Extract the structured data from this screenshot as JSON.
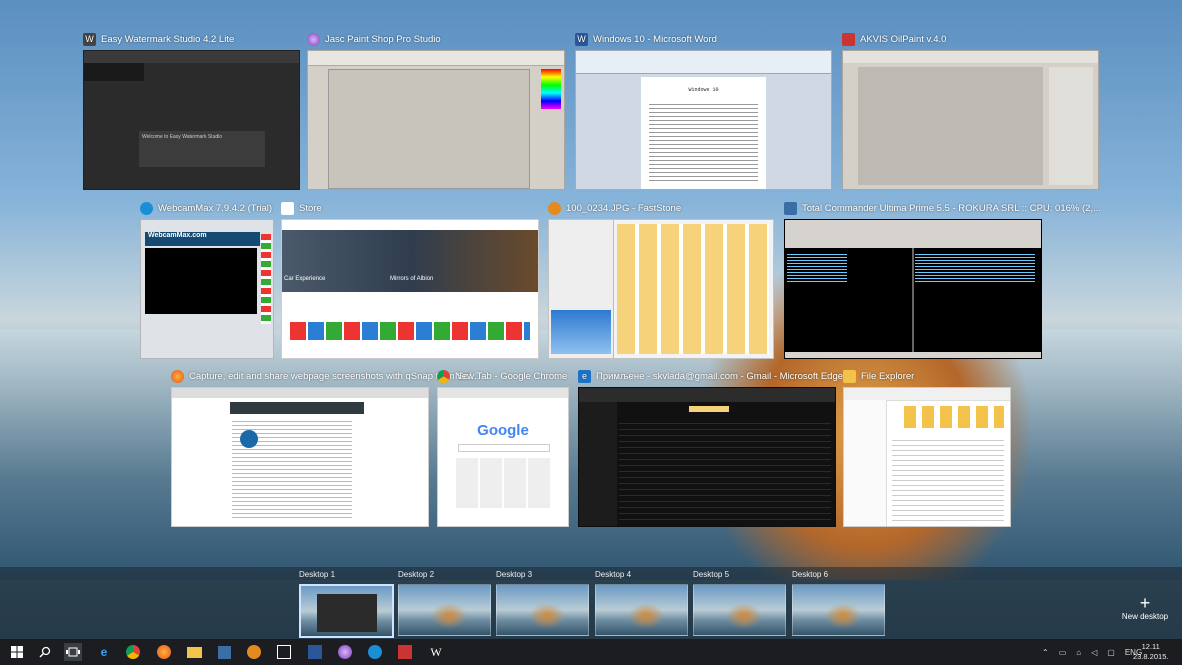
{
  "windows": [
    {
      "title": "Easy Watermark Studio 4.2 Lite",
      "icon": "W"
    },
    {
      "title": "Jasc Paint Shop Pro Studio",
      "icon": ""
    },
    {
      "title": "Windows 10 - Microsoft Word",
      "icon": ""
    },
    {
      "title": "AKVIS OilPaint v.4.0",
      "icon": ""
    },
    {
      "title": "WebcamMax  7.9.4.2  (Trial)",
      "icon": ""
    },
    {
      "title": "Store",
      "icon": ""
    },
    {
      "title": "100_0234.JPG - FastStone",
      "icon": ""
    },
    {
      "title": "Total Commander Ultima Prime 5.5 - ROKURA SRL :: CPU: 016% (2,...",
      "icon": ""
    },
    {
      "title": "Capture, edit and share webpage screenshots with qSnap from Sof...",
      "icon": ""
    },
    {
      "title": "New Tab - Google Chrome",
      "icon": ""
    },
    {
      "title": "Примљене - skvlada@gmail.com - Gmail - Microsoft Edge",
      "icon": ""
    },
    {
      "title": "File Explorer",
      "icon": ""
    }
  ],
  "thumb_text": {
    "watermark_welcome": "Welcome to Easy Watermark Studio",
    "word_heading": "Windows 10",
    "webcam_logo": "WebcamMax.com",
    "store_car": "Car Experience",
    "store_mirrors": "Mirrors of Albion",
    "google": "Google"
  },
  "desktops": [
    "Desktop 1",
    "Desktop 2",
    "Desktop 3",
    "Desktop 4",
    "Desktop 5",
    "Desktop 6"
  ],
  "new_desktop": {
    "label": "New desktop",
    "icon": "+"
  },
  "tray": {
    "lang": "ENG",
    "time": "12.11",
    "date": "23.8.2015."
  },
  "colors": {
    "taskbar": "#1b1d20",
    "accent": "#cfe5ff"
  }
}
